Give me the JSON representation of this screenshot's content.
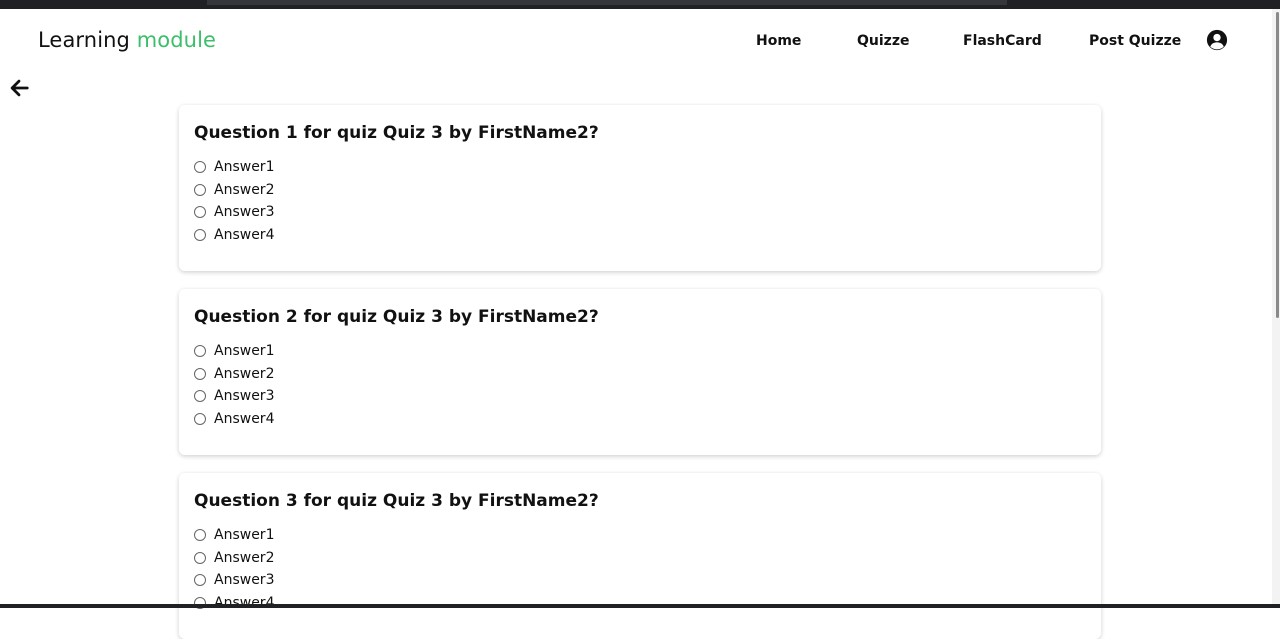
{
  "app": {
    "brand_part1": "Learning ",
    "brand_part2": "module",
    "brand_accent_color": "#3cbf6a"
  },
  "nav": {
    "home": "Home",
    "quizze": "Quizze",
    "flashcard": "FlashCard",
    "post_quizze": "Post Quizze",
    "user_icon": "user-circle-icon"
  },
  "back_icon": "arrow-left-icon",
  "questions": [
    {
      "text": "Question 1 for quiz Quiz 3 by FirstName2?",
      "answers": [
        "Answer1",
        "Answer2",
        "Answer3",
        "Answer4"
      ]
    },
    {
      "text": "Question 2 for quiz Quiz 3 by FirstName2?",
      "answers": [
        "Answer1",
        "Answer2",
        "Answer3",
        "Answer4"
      ]
    },
    {
      "text": "Question 3 for quiz Quiz 3 by FirstName2?",
      "answers": [
        "Answer1",
        "Answer2",
        "Answer3",
        "Answer4"
      ]
    }
  ]
}
